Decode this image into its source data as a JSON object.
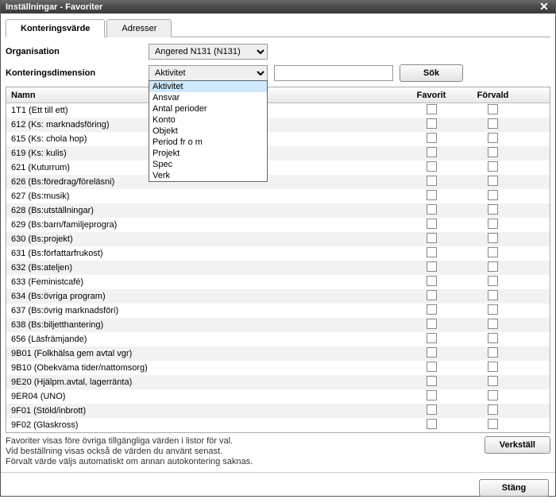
{
  "window": {
    "title": "Inställningar - Favoriter"
  },
  "tabs": {
    "t0": "Konteringsvärde",
    "t1": "Adresser"
  },
  "form": {
    "org_label": "Organisation",
    "org_value": "Angered N131 (N131)",
    "dim_label": "Konteringsdimension",
    "dim_value": "Aktivitet",
    "search_label": "Sök"
  },
  "dim_options": [
    "Aktivitet",
    "Ansvar",
    "Antal perioder",
    "Konto",
    "Objekt",
    "Period fr o m",
    "Projekt",
    "Spec",
    "Verk"
  ],
  "columns": {
    "name": "Namn",
    "fav": "Favorit",
    "def": "Förvald"
  },
  "rows": [
    "1T1 (Ett till ett)",
    "612 (Ks: marknadsföring)",
    "615 (Ks: chola hop)",
    "619 (Ks: kulis)",
    "621 (Kuturrum)",
    "626 (Bs:föredrag/föreläsni)",
    "627 (Bs:musik)",
    "628 (Bs:utställningar)",
    "629 (Bs:barn/familjeprogra)",
    "630 (Bs:projekt)",
    "631 (Bs:författarfrukost)",
    "632 (Bs:ateljen)",
    "633 (Feministcafé)",
    "634 (Bs:övriga program)",
    "637 (Bs:övrig marknadsföri)",
    "638 (Bs:biljetthantering)",
    "656 (Läsfrämjande)",
    "9B01 (Folkhälsa gem avtal vgr)",
    "9B10 (Obekväma tider/nattomsorg)",
    "9E20 (Hjälpm.avtal, lagerränta)",
    "9ER04 (UNO)",
    "9F01 (Stöld/inbrott)",
    "9F02 (Glaskross)"
  ],
  "footer": {
    "l1": "Favoriter visas före övriga tillgängliga värden i listor för val.",
    "l2": "Vid beställning visas också de värden du använt senast.",
    "l3": "Förvalt värde väljs automatiskt om annan autokontering saknas."
  },
  "buttons": {
    "apply": "Verkställ",
    "close": "Stäng"
  }
}
